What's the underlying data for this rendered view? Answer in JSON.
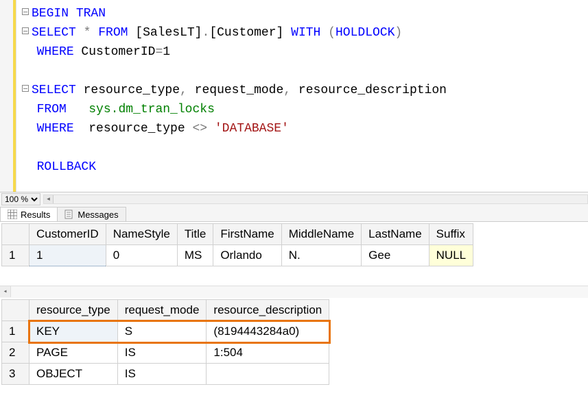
{
  "code": {
    "lines": [
      {
        "fold": true,
        "tokens": [
          {
            "t": "BEGIN",
            "c": "kw"
          },
          {
            "t": " "
          },
          {
            "t": "TRAN",
            "c": "kw"
          }
        ]
      },
      {
        "fold": true,
        "tokens": [
          {
            "t": "SELECT",
            "c": "kw"
          },
          {
            "t": " "
          },
          {
            "t": "*",
            "c": "op"
          },
          {
            "t": " "
          },
          {
            "t": "FROM",
            "c": "kw"
          },
          {
            "t": " [SalesLT]"
          },
          {
            "t": ".",
            "c": "op"
          },
          {
            "t": "[Customer] "
          },
          {
            "t": "WITH",
            "c": "kw"
          },
          {
            "t": " "
          },
          {
            "t": "(",
            "c": "op"
          },
          {
            "t": "HOLDLOCK",
            "c": "kw"
          },
          {
            "t": ")",
            "c": "op"
          }
        ]
      },
      {
        "fold": false,
        "tokens": [
          {
            "t": "WHERE",
            "c": "kw"
          },
          {
            "t": " CustomerID"
          },
          {
            "t": "=",
            "c": "op"
          },
          {
            "t": "1"
          }
        ]
      },
      {
        "fold": false,
        "tokens": [
          {
            "t": " "
          }
        ]
      },
      {
        "fold": true,
        "tokens": [
          {
            "t": "SELECT",
            "c": "kw"
          },
          {
            "t": " resource_type"
          },
          {
            "t": ",",
            "c": "op"
          },
          {
            "t": " request_mode"
          },
          {
            "t": ",",
            "c": "op"
          },
          {
            "t": " resource_description"
          }
        ]
      },
      {
        "fold": false,
        "tokens": [
          {
            "t": "FROM",
            "c": "kw"
          },
          {
            "t": "   "
          },
          {
            "t": "sys.dm_tran_locks",
            "c": "sys"
          }
        ]
      },
      {
        "fold": false,
        "tokens": [
          {
            "t": "WHERE",
            "c": "kw"
          },
          {
            "t": "  resource_type "
          },
          {
            "t": "<>",
            "c": "op"
          },
          {
            "t": " "
          },
          {
            "t": "'DATABASE'",
            "c": "str"
          }
        ]
      },
      {
        "fold": false,
        "tokens": [
          {
            "t": " "
          }
        ]
      },
      {
        "fold": false,
        "tokens": [
          {
            "t": "ROLLBACK",
            "c": "kw"
          }
        ]
      }
    ]
  },
  "zoom": {
    "value": "100 %"
  },
  "tabs": {
    "results": "Results",
    "messages": "Messages"
  },
  "grid1": {
    "headers": [
      "CustomerID",
      "NameStyle",
      "Title",
      "FirstName",
      "MiddleName",
      "LastName",
      "Suffix"
    ],
    "rows": [
      {
        "n": "1",
        "cells": [
          "1",
          "0",
          "MS",
          "Orlando",
          "N.",
          "Gee",
          "NULL"
        ],
        "null_cols": [
          6
        ],
        "sel_col": 0
      }
    ]
  },
  "grid2": {
    "headers": [
      "resource_type",
      "request_mode",
      "resource_description"
    ],
    "rows": [
      {
        "n": "1",
        "cells": [
          "KEY",
          "S",
          "(8194443284a0)"
        ],
        "sel_col": 0
      },
      {
        "n": "2",
        "cells": [
          "PAGE",
          "IS",
          "1:504"
        ]
      },
      {
        "n": "3",
        "cells": [
          "OBJECT",
          "IS",
          ""
        ]
      }
    ],
    "highlight_row": 0
  }
}
